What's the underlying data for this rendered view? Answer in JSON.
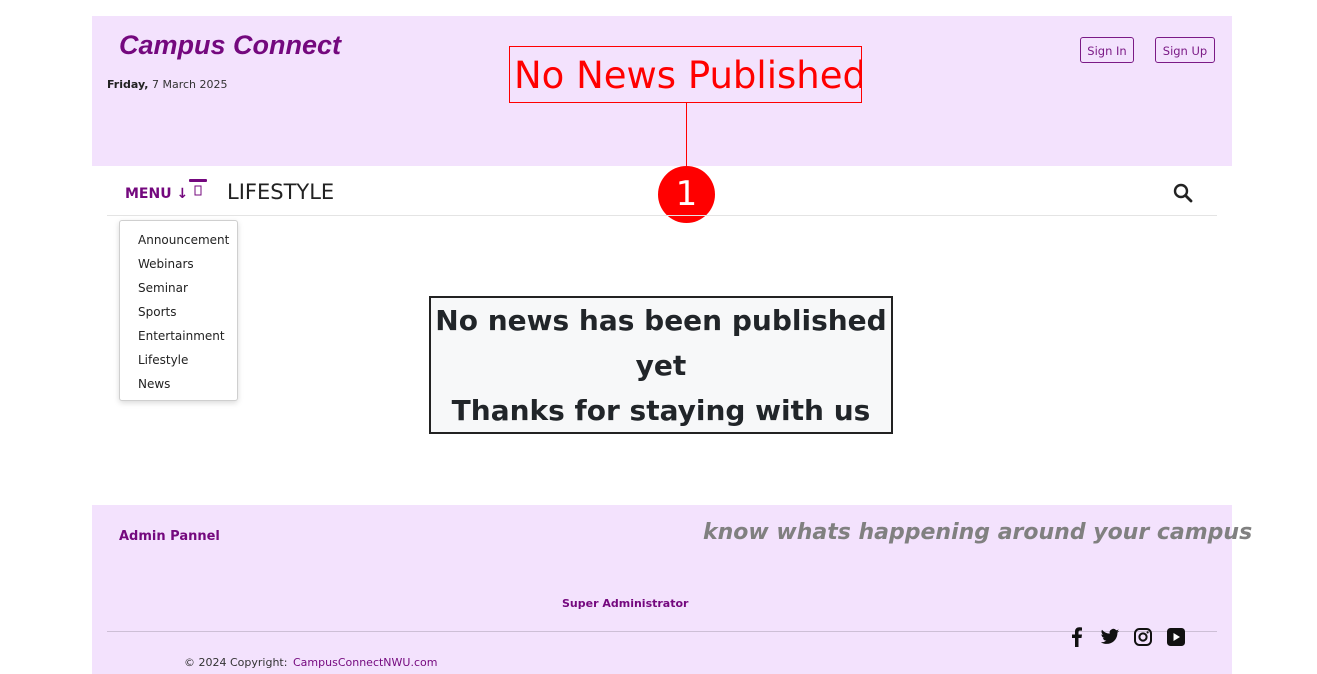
{
  "header": {
    "brand": "Campus Connect",
    "date_day": "Friday,",
    "date_rest": " 7 March 2025",
    "signin_label": "Sign In",
    "signup_label": "Sign Up"
  },
  "annotation": {
    "label": "No News Published",
    "badge": "1"
  },
  "nav": {
    "menu_label": "MENU ↓",
    "section_title": "LIFESTYLE",
    "icons": {
      "section": "book-bookmark-icon",
      "search": "search-icon"
    }
  },
  "dropdown": {
    "items": [
      "Announcement",
      "Webinars",
      "Seminar",
      "Sports",
      "Entertainment",
      "Lifestyle",
      "News"
    ]
  },
  "message": {
    "line1": "No news has been published",
    "line2": "yet",
    "line3": "Thanks for staying with us"
  },
  "footer": {
    "admin_label": "Admin Pannel",
    "tagline": "know whats happening around your campus",
    "super_admin": "Super Administrator",
    "copyright": "© 2024 Copyright:",
    "site_link": "CampusConnectNWU.com",
    "social": [
      "facebook-icon",
      "twitter-icon",
      "instagram-icon",
      "youtube-icon"
    ]
  },
  "colors": {
    "brand": "#74087e",
    "header_bg": "#f3e2fd",
    "annotation": "#ff0000",
    "tagline": "#808080"
  }
}
